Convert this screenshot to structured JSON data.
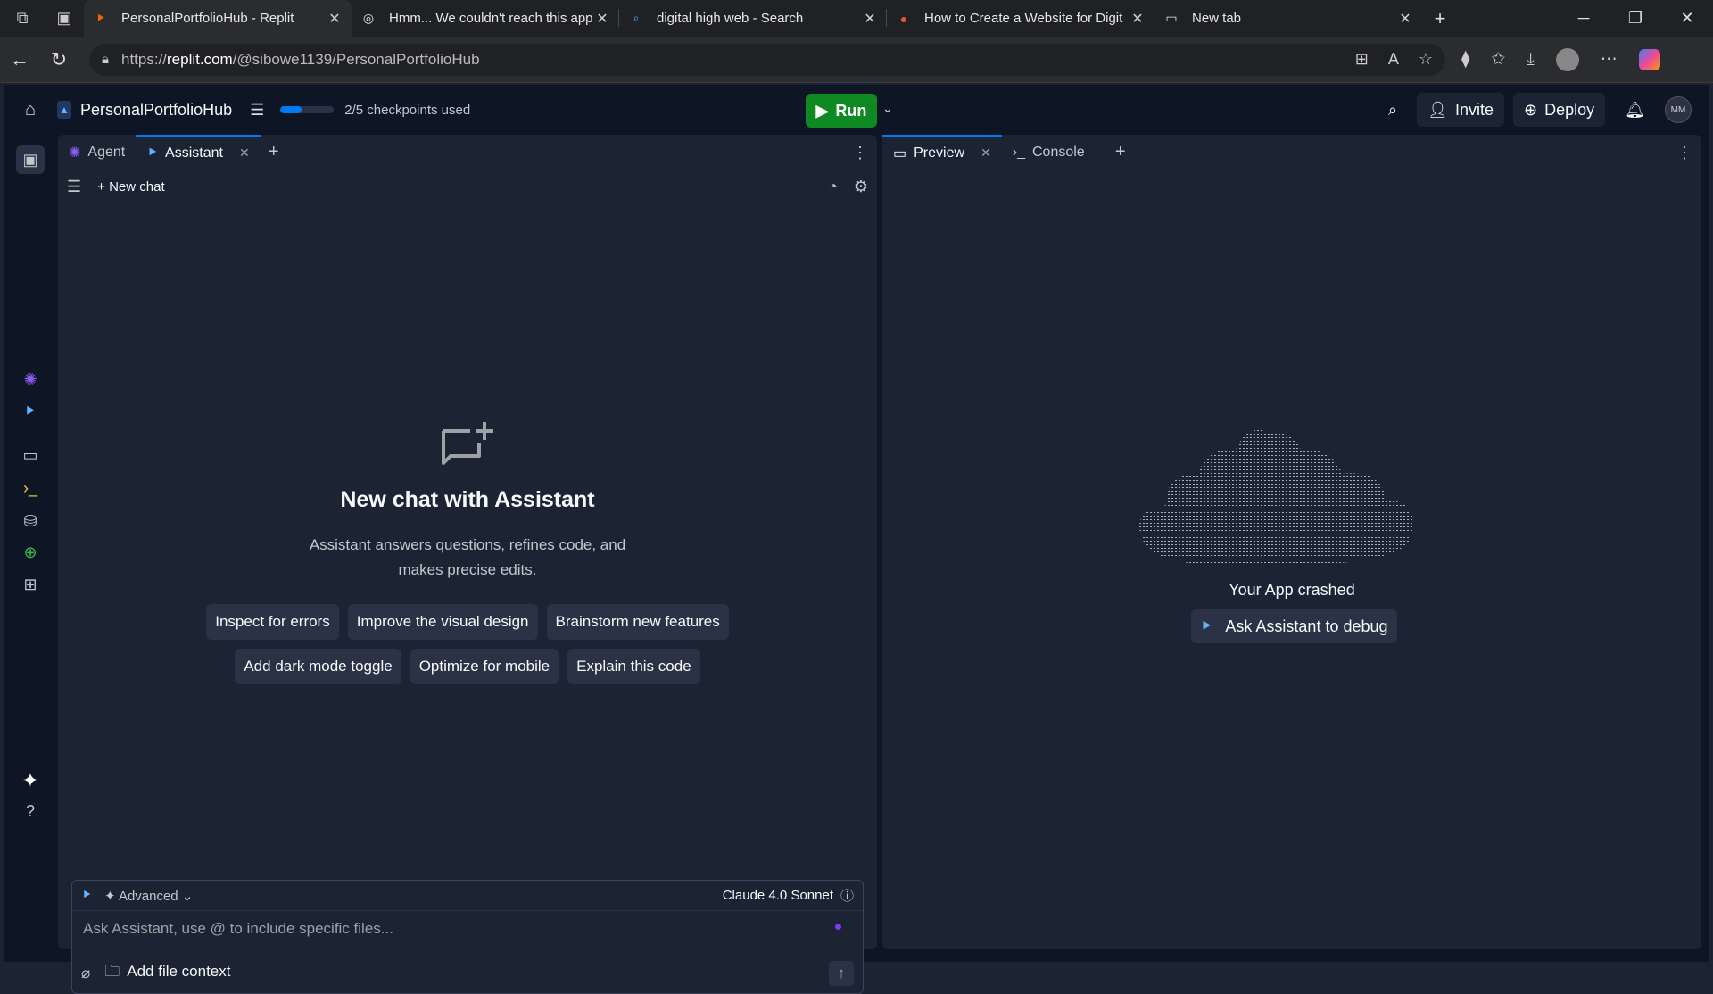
{
  "browser": {
    "tabs": [
      {
        "title": "PersonalPortfolioHub - Replit",
        "active": true
      },
      {
        "title": "Hmm... We couldn't reach this app",
        "active": false
      },
      {
        "title": "digital high web - Search",
        "active": false
      },
      {
        "title": "How to Create a Website for Digit",
        "active": false
      },
      {
        "title": "New tab",
        "active": false
      }
    ],
    "url_prefix": "https://",
    "url_host": "replit.com",
    "url_path": "/@sibowe1139/PersonalPortfolioHub"
  },
  "topbar": {
    "project_name": "PersonalPortfolioHub",
    "checkpoints_text": "2/5 checkpoints used",
    "checkpoint_progress": 0.4,
    "run_label": "Run",
    "invite_label": "Invite",
    "deploy_label": "Deploy",
    "user_initials": "MM"
  },
  "left_pane": {
    "tabs": [
      {
        "label": "Agent"
      },
      {
        "label": "Assistant"
      }
    ],
    "new_chat_label": "New chat",
    "empty_title": "New chat with Assistant",
    "empty_desc": "Assistant answers questions, refines code, and makes precise edits.",
    "suggestions": [
      "Inspect for errors",
      "Improve the visual design",
      "Brainstorm new features",
      "Add dark mode toggle",
      "Optimize for mobile",
      "Explain this code"
    ],
    "composer": {
      "mode_label": "Advanced",
      "model_label": "Claude 4.0 Sonnet",
      "placeholder": "Ask Assistant, use @ to include specific files...",
      "add_context_label": "Add file context"
    }
  },
  "right_pane": {
    "tabs": [
      {
        "label": "Preview"
      },
      {
        "label": "Console"
      }
    ],
    "crash_text": "Your App crashed",
    "debug_label": "Ask Assistant to debug"
  },
  "colors": {
    "run_green": "#0f8a22",
    "accent_blue": "#0079f2",
    "bg_dark": "#0e1525",
    "pane_bg": "#1c2333"
  }
}
